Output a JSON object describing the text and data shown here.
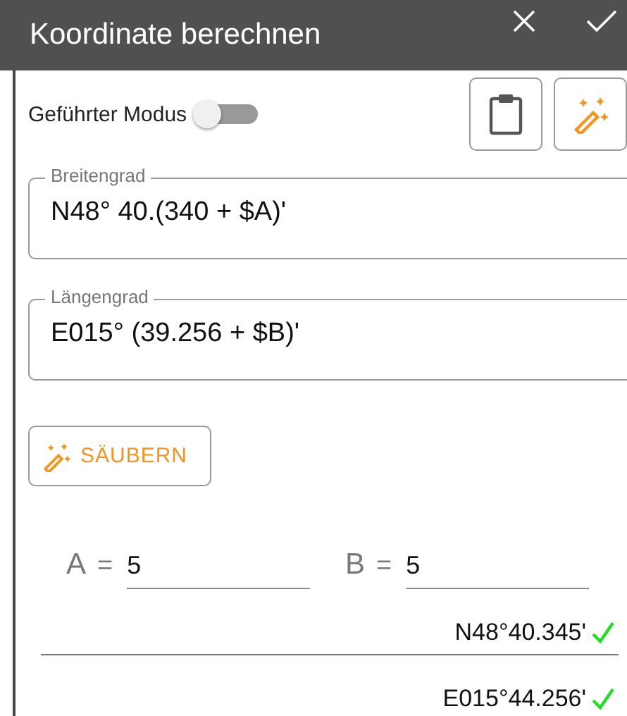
{
  "window": {
    "title": "Koordinate berechnen"
  },
  "guided_mode": {
    "label": "Geführter Modus",
    "on": false
  },
  "fields": [
    {
      "label": "Breitengrad",
      "value": "N48° 40.(340 + $A)'"
    },
    {
      "label": "Längengrad",
      "value": "E015° (39.256 + $B)'"
    }
  ],
  "clean_button": {
    "label": "SÄUBERN"
  },
  "variables": [
    {
      "name": "A",
      "equals": "=",
      "value": "5"
    },
    {
      "name": "B",
      "equals": "=",
      "value": "5"
    }
  ],
  "results": [
    {
      "text": "N48°40.345'",
      "valid": true
    },
    {
      "text": "E015°44.256'",
      "valid": true
    }
  ]
}
